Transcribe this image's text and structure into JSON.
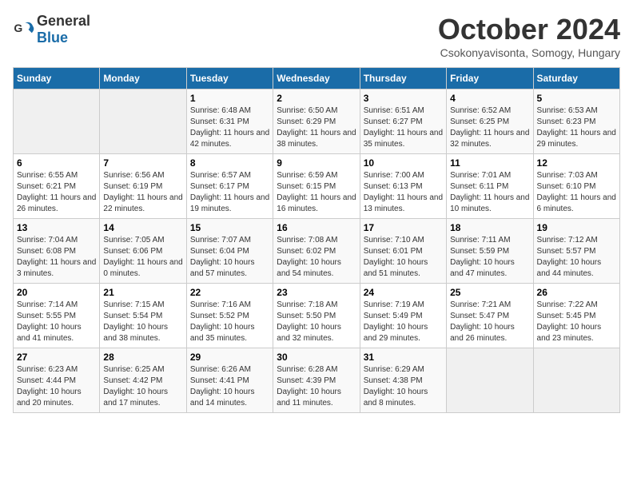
{
  "header": {
    "logo_general": "General",
    "logo_blue": "Blue",
    "month_year": "October 2024",
    "location": "Csokonyavisonta, Somogy, Hungary"
  },
  "weekdays": [
    "Sunday",
    "Monday",
    "Tuesday",
    "Wednesday",
    "Thursday",
    "Friday",
    "Saturday"
  ],
  "weeks": [
    [
      {
        "day": "",
        "sunrise": "",
        "sunset": "",
        "daylight": ""
      },
      {
        "day": "",
        "sunrise": "",
        "sunset": "",
        "daylight": ""
      },
      {
        "day": "1",
        "sunrise": "Sunrise: 6:48 AM",
        "sunset": "Sunset: 6:31 PM",
        "daylight": "Daylight: 11 hours and 42 minutes."
      },
      {
        "day": "2",
        "sunrise": "Sunrise: 6:50 AM",
        "sunset": "Sunset: 6:29 PM",
        "daylight": "Daylight: 11 hours and 38 minutes."
      },
      {
        "day": "3",
        "sunrise": "Sunrise: 6:51 AM",
        "sunset": "Sunset: 6:27 PM",
        "daylight": "Daylight: 11 hours and 35 minutes."
      },
      {
        "day": "4",
        "sunrise": "Sunrise: 6:52 AM",
        "sunset": "Sunset: 6:25 PM",
        "daylight": "Daylight: 11 hours and 32 minutes."
      },
      {
        "day": "5",
        "sunrise": "Sunrise: 6:53 AM",
        "sunset": "Sunset: 6:23 PM",
        "daylight": "Daylight: 11 hours and 29 minutes."
      }
    ],
    [
      {
        "day": "6",
        "sunrise": "Sunrise: 6:55 AM",
        "sunset": "Sunset: 6:21 PM",
        "daylight": "Daylight: 11 hours and 26 minutes."
      },
      {
        "day": "7",
        "sunrise": "Sunrise: 6:56 AM",
        "sunset": "Sunset: 6:19 PM",
        "daylight": "Daylight: 11 hours and 22 minutes."
      },
      {
        "day": "8",
        "sunrise": "Sunrise: 6:57 AM",
        "sunset": "Sunset: 6:17 PM",
        "daylight": "Daylight: 11 hours and 19 minutes."
      },
      {
        "day": "9",
        "sunrise": "Sunrise: 6:59 AM",
        "sunset": "Sunset: 6:15 PM",
        "daylight": "Daylight: 11 hours and 16 minutes."
      },
      {
        "day": "10",
        "sunrise": "Sunrise: 7:00 AM",
        "sunset": "Sunset: 6:13 PM",
        "daylight": "Daylight: 11 hours and 13 minutes."
      },
      {
        "day": "11",
        "sunrise": "Sunrise: 7:01 AM",
        "sunset": "Sunset: 6:11 PM",
        "daylight": "Daylight: 11 hours and 10 minutes."
      },
      {
        "day": "12",
        "sunrise": "Sunrise: 7:03 AM",
        "sunset": "Sunset: 6:10 PM",
        "daylight": "Daylight: 11 hours and 6 minutes."
      }
    ],
    [
      {
        "day": "13",
        "sunrise": "Sunrise: 7:04 AM",
        "sunset": "Sunset: 6:08 PM",
        "daylight": "Daylight: 11 hours and 3 minutes."
      },
      {
        "day": "14",
        "sunrise": "Sunrise: 7:05 AM",
        "sunset": "Sunset: 6:06 PM",
        "daylight": "Daylight: 11 hours and 0 minutes."
      },
      {
        "day": "15",
        "sunrise": "Sunrise: 7:07 AM",
        "sunset": "Sunset: 6:04 PM",
        "daylight": "Daylight: 10 hours and 57 minutes."
      },
      {
        "day": "16",
        "sunrise": "Sunrise: 7:08 AM",
        "sunset": "Sunset: 6:02 PM",
        "daylight": "Daylight: 10 hours and 54 minutes."
      },
      {
        "day": "17",
        "sunrise": "Sunrise: 7:10 AM",
        "sunset": "Sunset: 6:01 PM",
        "daylight": "Daylight: 10 hours and 51 minutes."
      },
      {
        "day": "18",
        "sunrise": "Sunrise: 7:11 AM",
        "sunset": "Sunset: 5:59 PM",
        "daylight": "Daylight: 10 hours and 47 minutes."
      },
      {
        "day": "19",
        "sunrise": "Sunrise: 7:12 AM",
        "sunset": "Sunset: 5:57 PM",
        "daylight": "Daylight: 10 hours and 44 minutes."
      }
    ],
    [
      {
        "day": "20",
        "sunrise": "Sunrise: 7:14 AM",
        "sunset": "Sunset: 5:55 PM",
        "daylight": "Daylight: 10 hours and 41 minutes."
      },
      {
        "day": "21",
        "sunrise": "Sunrise: 7:15 AM",
        "sunset": "Sunset: 5:54 PM",
        "daylight": "Daylight: 10 hours and 38 minutes."
      },
      {
        "day": "22",
        "sunrise": "Sunrise: 7:16 AM",
        "sunset": "Sunset: 5:52 PM",
        "daylight": "Daylight: 10 hours and 35 minutes."
      },
      {
        "day": "23",
        "sunrise": "Sunrise: 7:18 AM",
        "sunset": "Sunset: 5:50 PM",
        "daylight": "Daylight: 10 hours and 32 minutes."
      },
      {
        "day": "24",
        "sunrise": "Sunrise: 7:19 AM",
        "sunset": "Sunset: 5:49 PM",
        "daylight": "Daylight: 10 hours and 29 minutes."
      },
      {
        "day": "25",
        "sunrise": "Sunrise: 7:21 AM",
        "sunset": "Sunset: 5:47 PM",
        "daylight": "Daylight: 10 hours and 26 minutes."
      },
      {
        "day": "26",
        "sunrise": "Sunrise: 7:22 AM",
        "sunset": "Sunset: 5:45 PM",
        "daylight": "Daylight: 10 hours and 23 minutes."
      }
    ],
    [
      {
        "day": "27",
        "sunrise": "Sunrise: 6:23 AM",
        "sunset": "Sunset: 4:44 PM",
        "daylight": "Daylight: 10 hours and 20 minutes."
      },
      {
        "day": "28",
        "sunrise": "Sunrise: 6:25 AM",
        "sunset": "Sunset: 4:42 PM",
        "daylight": "Daylight: 10 hours and 17 minutes."
      },
      {
        "day": "29",
        "sunrise": "Sunrise: 6:26 AM",
        "sunset": "Sunset: 4:41 PM",
        "daylight": "Daylight: 10 hours and 14 minutes."
      },
      {
        "day": "30",
        "sunrise": "Sunrise: 6:28 AM",
        "sunset": "Sunset: 4:39 PM",
        "daylight": "Daylight: 10 hours and 11 minutes."
      },
      {
        "day": "31",
        "sunrise": "Sunrise: 6:29 AM",
        "sunset": "Sunset: 4:38 PM",
        "daylight": "Daylight: 10 hours and 8 minutes."
      },
      {
        "day": "",
        "sunrise": "",
        "sunset": "",
        "daylight": ""
      },
      {
        "day": "",
        "sunrise": "",
        "sunset": "",
        "daylight": ""
      }
    ]
  ]
}
